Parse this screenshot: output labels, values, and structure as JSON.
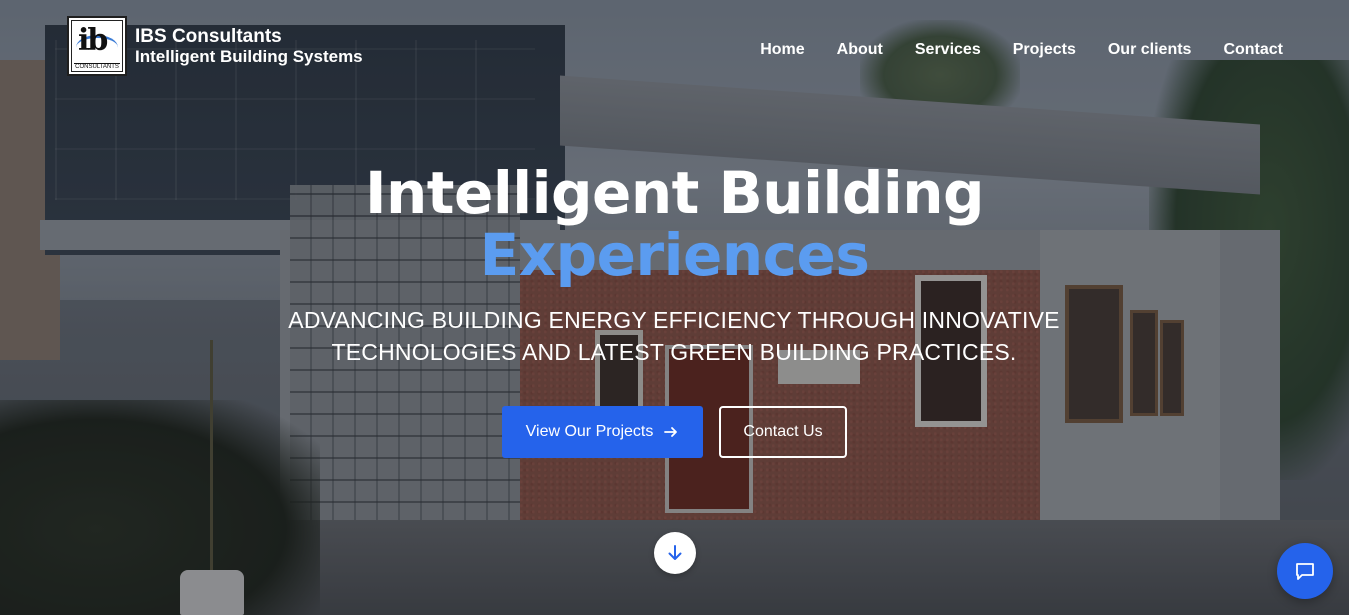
{
  "brand": {
    "logo_letters": "ib",
    "logo_caption": "CONSULTANTS",
    "name": "IBS Consultants",
    "subtitle": "Intelligent Building Systems"
  },
  "nav": {
    "items": [
      {
        "label": "Home"
      },
      {
        "label": "About"
      },
      {
        "label": "Services"
      },
      {
        "label": "Projects"
      },
      {
        "label": "Our clients"
      },
      {
        "label": "Contact"
      }
    ]
  },
  "hero": {
    "title_line1": "Intelligent Building",
    "title_line2": "Experiences",
    "tagline": "ADVANCING BUILDING ENERGY EFFICIENCY THROUGH INNOVATIVE TECHNOLOGIES AND LATEST GREEN BUILDING PRACTICES.",
    "primary_cta": "View Our Projects",
    "secondary_cta": "Contact Us"
  },
  "icons": {
    "primary_cta_icon": "arrow-right-icon",
    "scroll_icon": "arrow-down-icon",
    "chat_icon": "chat-icon"
  },
  "colors": {
    "accent": "#2563eb",
    "highlight_text": "#5b9cf0",
    "nav_text": "#ffffff"
  }
}
